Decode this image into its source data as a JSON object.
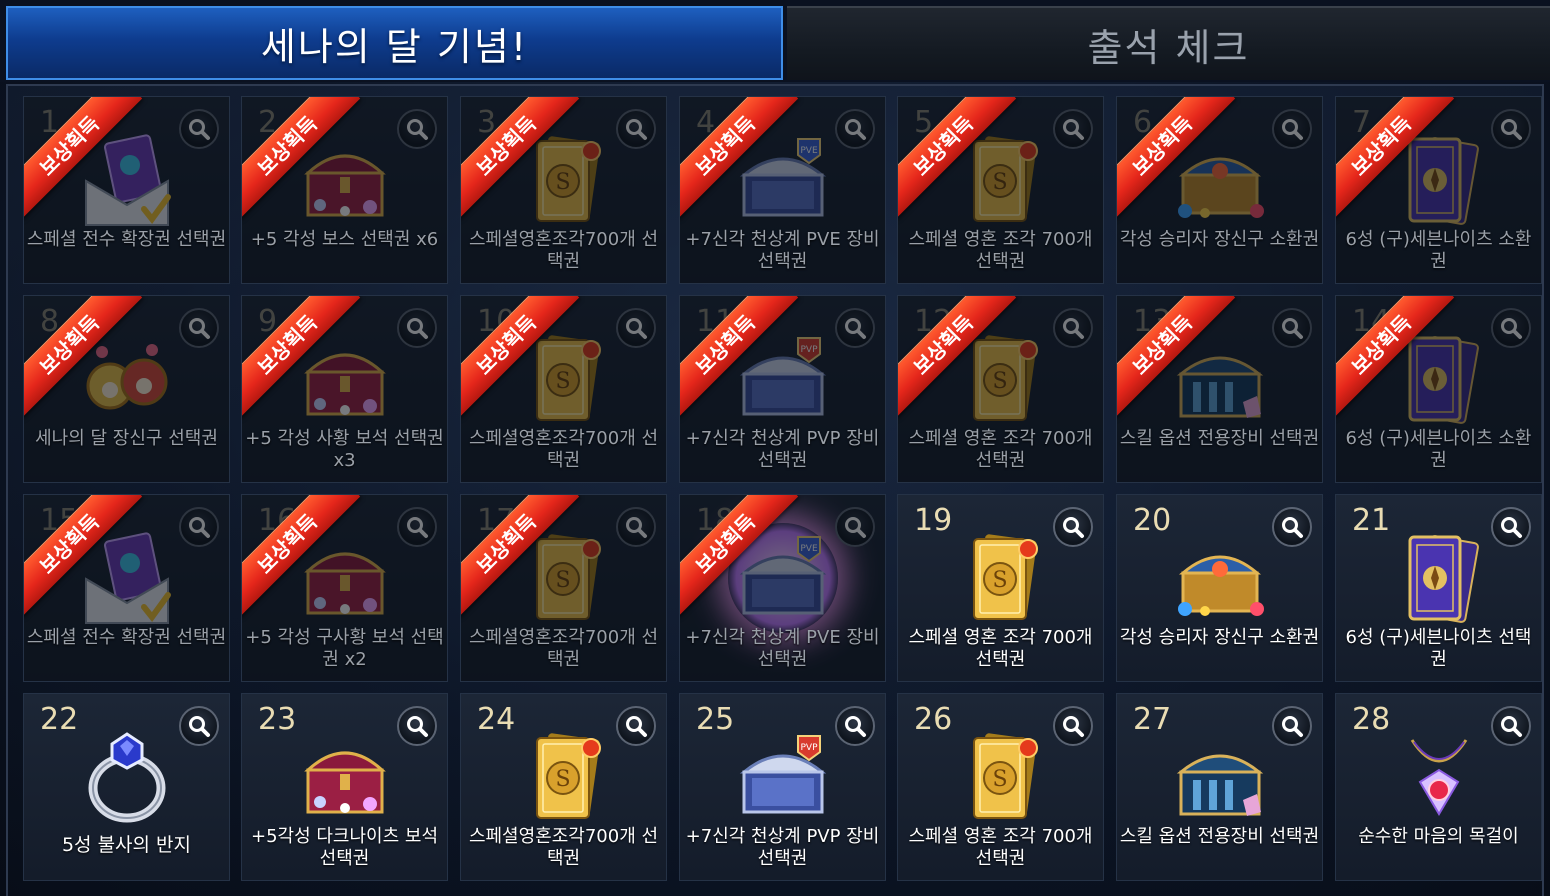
{
  "tabs": {
    "active": "세나의 달 기념!",
    "inactive": "출석 체크"
  },
  "claimed_label": "보상획득",
  "items": [
    {
      "day": "1",
      "label": "스페셜 전수 확장권 선택권",
      "icon": "ticket-envelope-icon",
      "claimed": true
    },
    {
      "day": "2",
      "label": "+5 각성 보스 선택권 x6",
      "icon": "red-treasure-chest-icon",
      "claimed": true
    },
    {
      "day": "3",
      "label": "스페셜영혼조각700개 선택권",
      "icon": "gold-card-icon",
      "claimed": true
    },
    {
      "day": "4",
      "label": "+7신각 천상계 PVE 장비 선택권",
      "icon": "pve-chest-icon",
      "claimed": true
    },
    {
      "day": "5",
      "label": "스페셜 영혼 조각 700개 선택권",
      "icon": "gold-card-icon",
      "claimed": true
    },
    {
      "day": "6",
      "label": "각성 승리자 장신구 소환권",
      "icon": "gem-chest-icon",
      "claimed": true
    },
    {
      "day": "7",
      "label": "6성 (구)세븐나이츠 소환권",
      "icon": "purple-card-icon",
      "claimed": true
    },
    {
      "day": "8",
      "label": "세나의 달 장신구 선택권",
      "icon": "accessory-icon",
      "claimed": true
    },
    {
      "day": "9",
      "label": "+5 각성 사황 보석 선택권 x3",
      "icon": "red-treasure-chest-icon",
      "claimed": true
    },
    {
      "day": "10",
      "label": "스페셜영혼조각700개 선택권",
      "icon": "gold-card-icon",
      "claimed": true
    },
    {
      "day": "11",
      "label": "+7신각 천상계 PVP 장비 선택권",
      "icon": "pvp-chest-icon",
      "claimed": true
    },
    {
      "day": "12",
      "label": "스페셜 영혼 조각 700개 선택권",
      "icon": "gold-card-icon",
      "claimed": true
    },
    {
      "day": "13",
      "label": "스킬 옵션 전용장비 선택권",
      "icon": "blue-chest-icon",
      "claimed": true
    },
    {
      "day": "14",
      "label": "6성 (구)세븐나이츠 소환권",
      "icon": "purple-card-icon",
      "claimed": true
    },
    {
      "day": "15",
      "label": "스페셜 전수 확장권 선택권",
      "icon": "ticket-envelope-icon",
      "claimed": true
    },
    {
      "day": "16",
      "label": "+5 각성 구사황 보석 선택권 x2",
      "icon": "red-treasure-chest-icon",
      "claimed": true
    },
    {
      "day": "17",
      "label": "스페셜영혼조각700개 선택권",
      "icon": "gold-card-icon",
      "claimed": true
    },
    {
      "day": "18",
      "label": "+7신각 천상계 PVE 장비 선택권",
      "icon": "pve-chest-icon",
      "claimed": true,
      "glow": true
    },
    {
      "day": "19",
      "label": "스페셜 영혼 조각 700개 선택권",
      "icon": "gold-card-icon",
      "claimed": false
    },
    {
      "day": "20",
      "label": "각성 승리자 장신구 소환권",
      "icon": "gem-chest-icon",
      "claimed": false
    },
    {
      "day": "21",
      "label": "6성 (구)세븐나이츠 선택권",
      "icon": "purple-card-icon",
      "claimed": false
    },
    {
      "day": "22",
      "label": "5성 불사의 반지",
      "icon": "ring-icon",
      "claimed": false
    },
    {
      "day": "23",
      "label": "+5각성 다크나이츠 보석 선택권",
      "icon": "red-treasure-chest-icon",
      "claimed": false
    },
    {
      "day": "24",
      "label": "스페셜영혼조각700개 선택권",
      "icon": "gold-card-icon",
      "claimed": false
    },
    {
      "day": "25",
      "label": "+7신각 천상계 PVP 장비 선택권",
      "icon": "pvp-chest-icon",
      "claimed": false
    },
    {
      "day": "26",
      "label": "스페셜 영혼 조각 700개 선택권",
      "icon": "gold-card-icon",
      "claimed": false
    },
    {
      "day": "27",
      "label": "스킬 옵션 전용장비 선택권",
      "icon": "blue-chest-icon",
      "claimed": false
    },
    {
      "day": "28",
      "label": "순수한 마음의 목걸이",
      "icon": "necklace-icon",
      "claimed": false
    }
  ]
}
